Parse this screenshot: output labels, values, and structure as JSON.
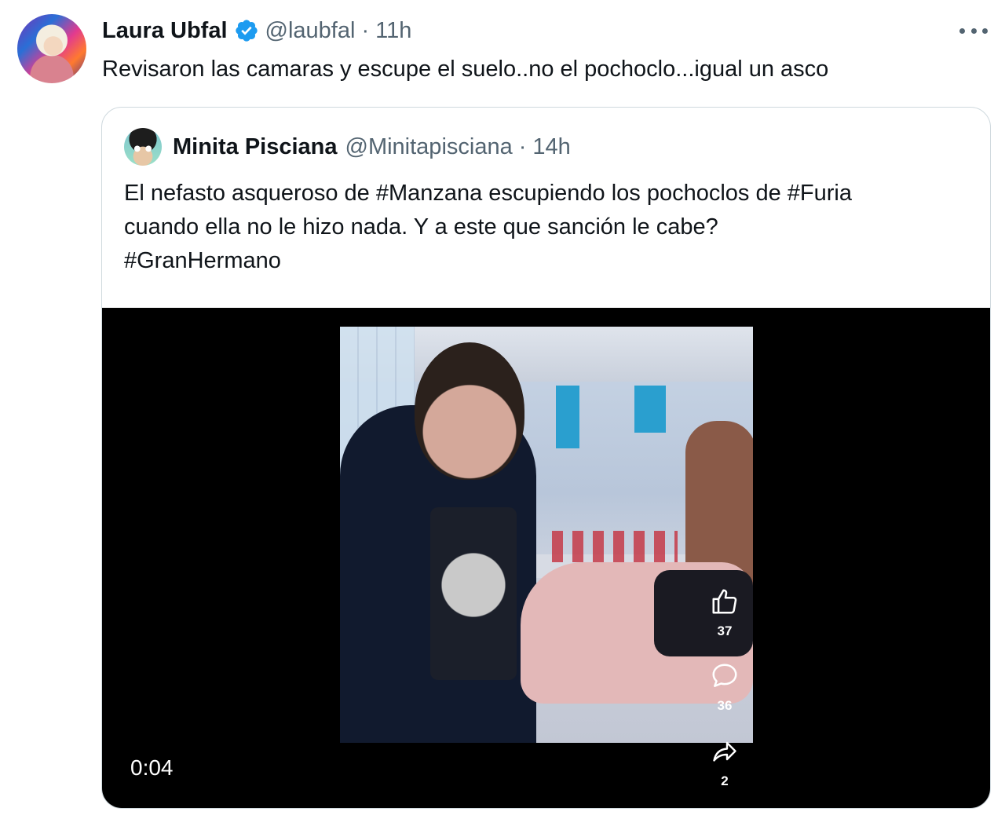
{
  "tweet": {
    "author": {
      "display_name": "Laura Ubfal",
      "handle": "@laubfal",
      "verified": true
    },
    "time_separator": "·",
    "time": "11h",
    "text": "Revisaron las camaras y escupe el suelo..no el pochoclo...igual un asco",
    "more_icon": "more-horizontal-icon"
  },
  "quoted_tweet": {
    "author": {
      "display_name": "Minita Pisciana",
      "handle": "@Minitapisciana"
    },
    "time_separator": "·",
    "time": "14h",
    "text_lines": [
      "El nefasto asqueroso de #Manzana escupiendo los pochoclos de #Furia",
      "cuando ella no le hizo nada. Y a este que sanción le cabe?",
      "#GranHermano"
    ],
    "video": {
      "duration": "0:04",
      "actions": [
        {
          "icon": "thumbs-up-icon",
          "count": "37"
        },
        {
          "icon": "comment-icon",
          "count": "36"
        },
        {
          "icon": "share-icon",
          "count": "2"
        }
      ]
    }
  },
  "colors": {
    "text_primary": "#0f1419",
    "text_secondary": "#536471",
    "verified_blue": "#1d9bf0",
    "border": "#cfd9de"
  }
}
